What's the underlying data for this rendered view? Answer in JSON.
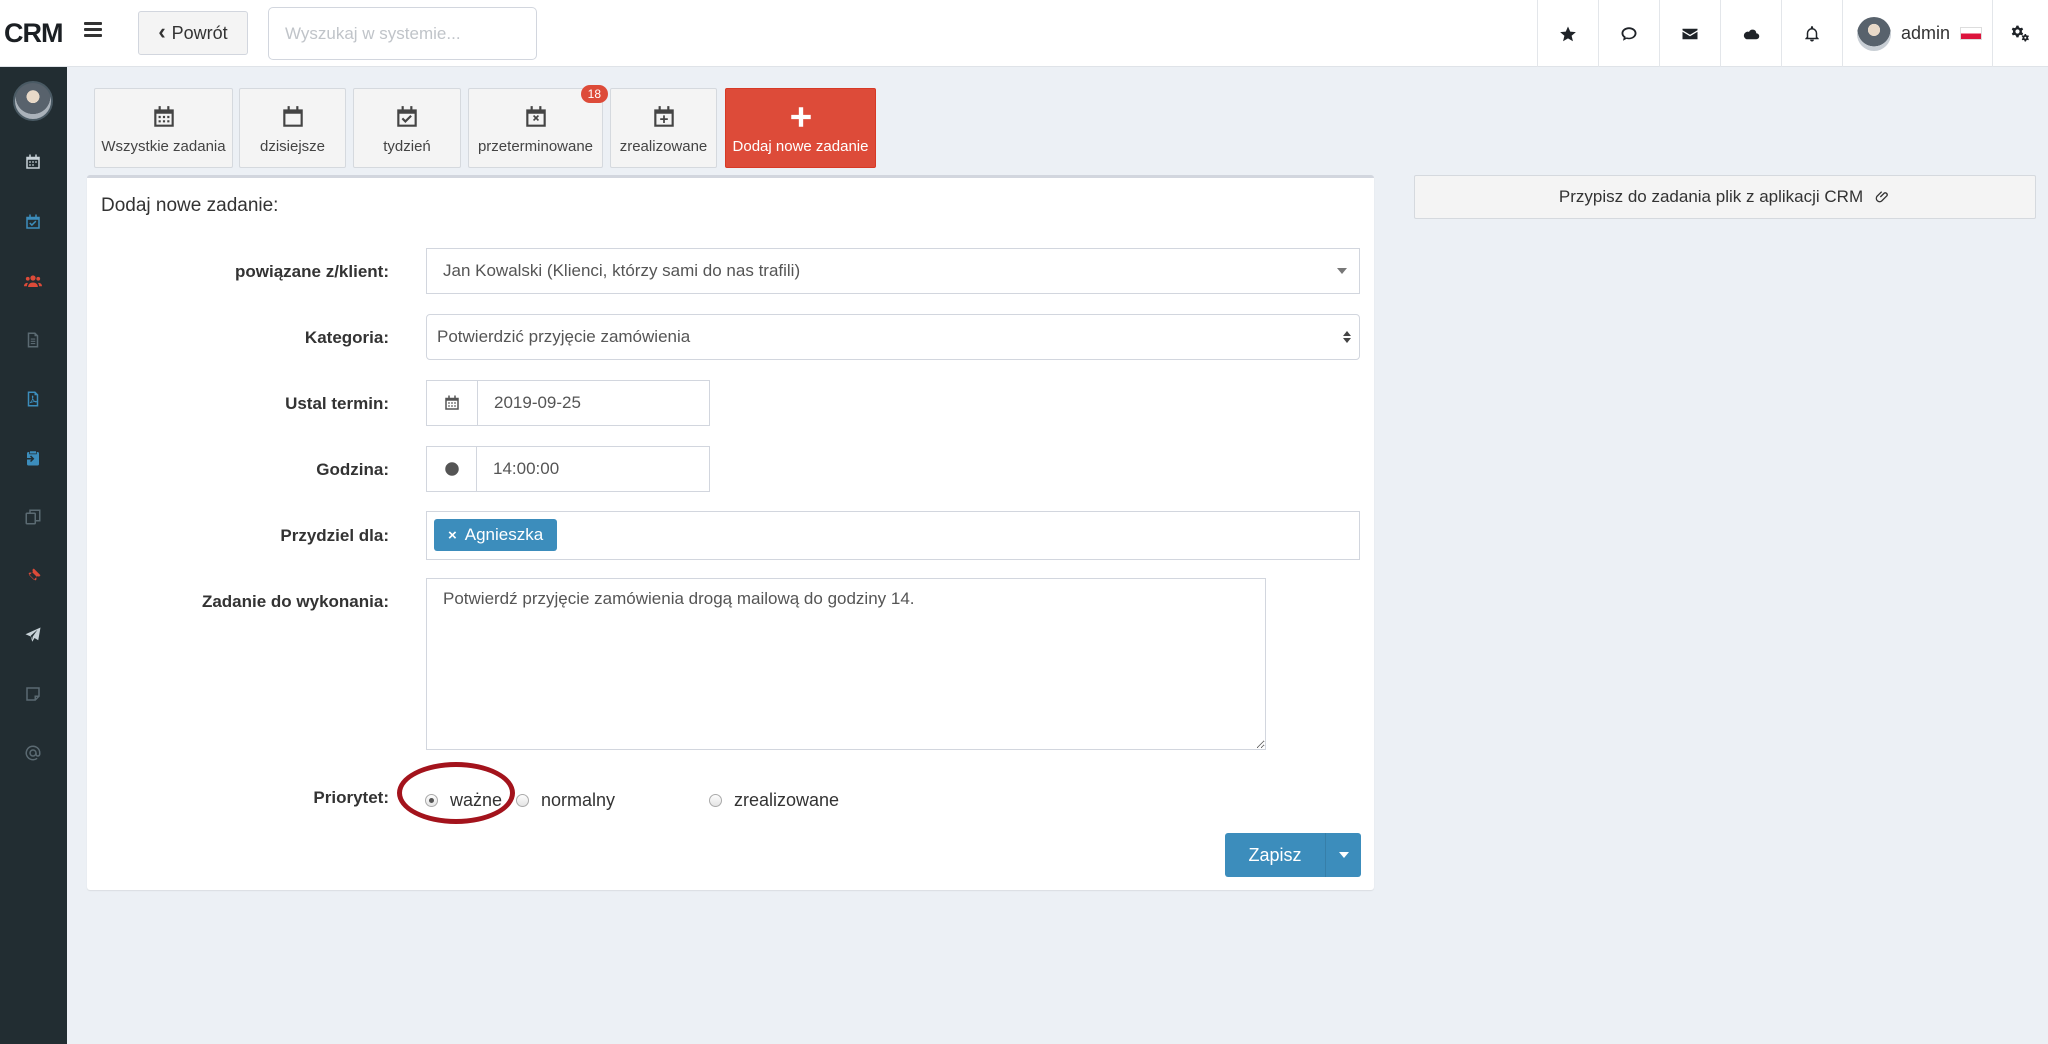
{
  "header": {
    "logo": "CRM",
    "back_label": "Powrót",
    "search_placeholder": "Wyszukaj w systemie...",
    "username": "admin"
  },
  "tabs": [
    {
      "label": "Wszystkie zadania"
    },
    {
      "label": "dzisiejsze"
    },
    {
      "label": "tydzień"
    },
    {
      "label": "przeterminowane",
      "badge": "18"
    },
    {
      "label": "zrealizowane"
    },
    {
      "label": "Dodaj nowe zadanie"
    }
  ],
  "form": {
    "title": "Dodaj nowe zadanie:",
    "client_label": "powiązane z/klient:",
    "client_value": "Jan Kowalski (Klienci, którzy sami do nas trafili)",
    "category_label": "Kategoria:",
    "category_value": "Potwierdzić przyjęcie zamówienia",
    "date_label": "Ustal termin:",
    "date_value": "2019-09-25",
    "time_label": "Godzina:",
    "time_value": "14:00:00",
    "assign_label": "Przydziel dla:",
    "assign_tag": "Agnieszka",
    "task_label": "Zadanie do wykonania:",
    "task_value": "Potwierdź przyjęcie zamówienia drogą mailową do godziny 14.",
    "priority_label": "Priorytet:",
    "priority_options": [
      "ważne",
      "normalny",
      "zrealizowane"
    ],
    "priority_selected": "ważne",
    "save_label": "Zapisz"
  },
  "attach": {
    "label": "Przypisz do zadania plik z aplikacji CRM"
  },
  "colors": {
    "accent_blue": "#3c8dbc",
    "accent_red": "#dd4b39",
    "sidebar": "#222d32",
    "highlight": "#a3131c"
  }
}
